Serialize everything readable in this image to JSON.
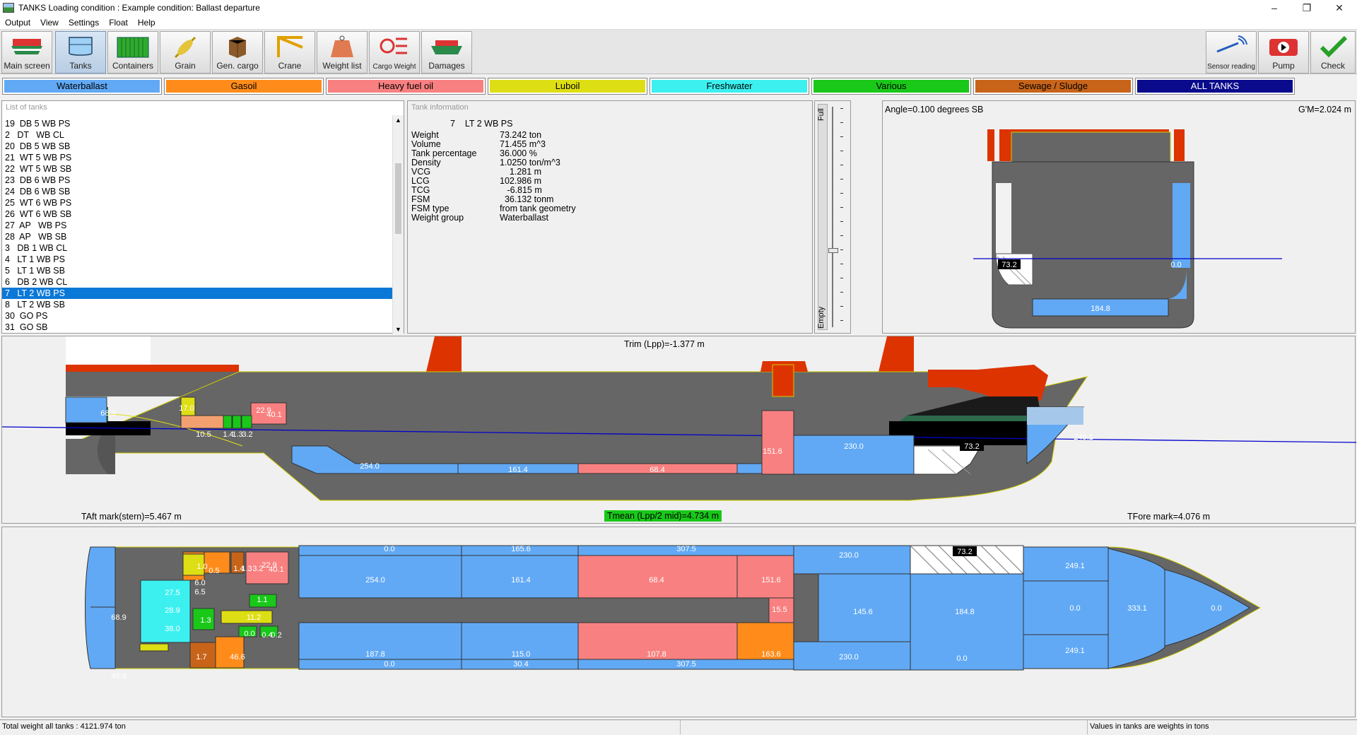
{
  "window": {
    "title": "TANKS  Loading condition : Example condition: Ballast departure",
    "min_icon": "–",
    "max_icon": "❐",
    "close_icon": "✕"
  },
  "menu": [
    "Output",
    "View",
    "Settings",
    "Float",
    "Help"
  ],
  "toolbar": {
    "left": [
      "Main screen",
      "Tanks",
      "Containers",
      "Grain",
      "Gen. cargo",
      "Crane",
      "Weight list",
      "Cargo Weight",
      "Damages"
    ],
    "right": [
      "Sensor reading",
      "Pump",
      "Check"
    ],
    "active": "Tanks"
  },
  "categories": [
    {
      "label": "Waterballast",
      "color": "#61a9f5"
    },
    {
      "label": "Gasoil",
      "color": "#ff8c1a"
    },
    {
      "label": "Heavy fuel oil",
      "color": "#f98080"
    },
    {
      "label": "Luboil",
      "color": "#dede14"
    },
    {
      "label": "Freshwater",
      "color": "#3cf0f0"
    },
    {
      "label": "Various",
      "color": "#19c819"
    },
    {
      "label": "Sewage / Sludge",
      "color": "#c86419"
    },
    {
      "label": "ALL TANKS",
      "color": "#0a0a8c"
    }
  ],
  "list_panel": {
    "header": "List of tanks",
    "items": [
      "19  DB 5 WB PS",
      "2   DT   WB CL",
      "20  DB 5 WB SB",
      "21  WT 5 WB PS",
      "22  WT 5 WB SB",
      "23  DB 6 WB PS",
      "24  DB 6 WB SB",
      "25  WT 6 WB PS",
      "26  WT 6 WB SB",
      "27  AP   WB PS",
      "28  AP   WB SB",
      "3   DB 1 WB CL",
      "4   LT 1 WB PS",
      "5   LT 1 WB SB",
      "6   DB 2 WB CL",
      "7   LT 2 WB PS",
      "8   LT 2 WB SB",
      "30  GO PS",
      "31  GO SB"
    ],
    "selected_index": 15
  },
  "info_panel": {
    "header": "Tank information",
    "title": "7    LT 2 WB PS",
    "rows": [
      {
        "k": "Weight",
        "v": "73.242 ton"
      },
      {
        "k": "Volume",
        "v": "71.455 m^3"
      },
      {
        "k": "Tank percentage",
        "v": "36.000 %"
      },
      {
        "k": "Density",
        "v": "1.0250 ton/m^3"
      },
      {
        "k": "VCG",
        "v": "    1.281 m"
      },
      {
        "k": "LCG",
        "v": "102.986 m"
      },
      {
        "k": "TCG",
        "v": "   -6.815 m"
      },
      {
        "k": "FSM",
        "v": "  36.132 tonm"
      },
      {
        "k": "FSM type",
        "v": "from tank geometry"
      },
      {
        "k": "Weight group",
        "v": "Waterballast"
      }
    ]
  },
  "gauge": {
    "full_label": "Full",
    "empty_label": "Empty",
    "level": 0.36
  },
  "section_view": {
    "angle_text": "Angle=0.100 degrees SB",
    "gm_text": "G'M=2.024 m",
    "labels": [
      "73.2",
      "0.0",
      "184.8"
    ]
  },
  "profile_view": {
    "trim_text": "Trim (Lpp)=-1.377 m",
    "aft_text": "TAft mark(stern)=5.467 m",
    "mean_text": "Tmean (Lpp/2 mid)=4.734 m",
    "fore_text": "TFore mark=4.076 m",
    "labels": [
      "68.9",
      "17.0",
      "22.9",
      "40.1",
      "10.5",
      "1.4",
      "1.3",
      "3.2",
      "254.0",
      "161.4",
      "68.4",
      "151.6",
      "230.0",
      "73.2",
      "249.1"
    ]
  },
  "plan_view": {
    "labels": [
      "68.9",
      "46.9",
      "27.5",
      "28.9",
      "38.0",
      "1.3",
      "1.0",
      "0.5",
      "1.4",
      "1.3",
      "3.2",
      "6.0",
      "6.5",
      "22.9",
      "40.1",
      "1.1",
      "11.2",
      "0.0",
      "0.4",
      "0.2",
      "1.7",
      "46.6",
      "0.0",
      "254.0",
      "187.8",
      "0.0",
      "165.6",
      "161.4",
      "115.0",
      "30.4",
      "307.5",
      "68.4",
      "107.8",
      "307.5",
      "151.6",
      "163.6",
      "15.5",
      "230.0",
      "145.6",
      "230.0",
      "73.2",
      "184.8",
      "0.0",
      "249.1",
      "0.0",
      "249.1",
      "333.1",
      "0.0",
      "0.0",
      "0.0",
      "0.0"
    ]
  },
  "status": {
    "total": "Total weight all tanks :  4121.974 ton",
    "note": "Values in tanks are weights in tons"
  }
}
